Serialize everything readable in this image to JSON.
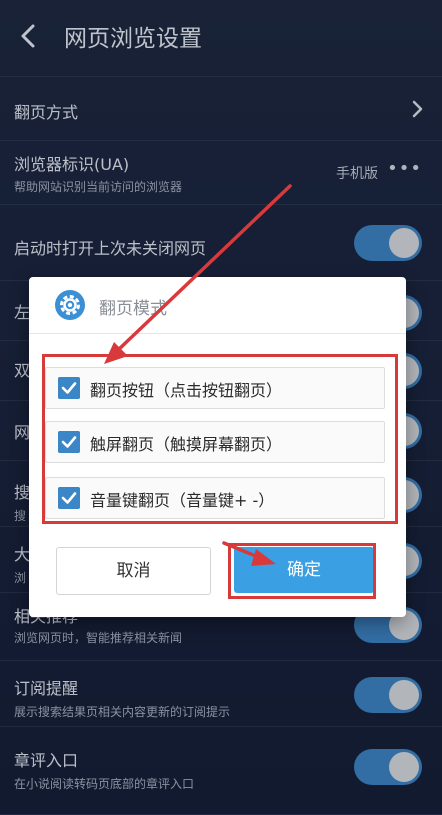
{
  "header": {
    "title": "网页浏览设置"
  },
  "settings": [
    {
      "label": "翻页方式"
    },
    {
      "label": "浏览器标识(UA)",
      "sub": "帮助网站识别当前访问的浏览器",
      "value": "手机版",
      "more": "•••"
    },
    {
      "label": "启动时打开上次未关闭网页",
      "on": true
    },
    {
      "label": "左",
      "on": true
    },
    {
      "label": "双",
      "on": true
    },
    {
      "label": "网",
      "on": true
    },
    {
      "label": "搜",
      "sub": "搜",
      "on": true
    },
    {
      "label": "大",
      "sub": "浏",
      "on": true
    },
    {
      "label": "相关推荐",
      "sub": "浏览网页时，智能推荐相关新闻",
      "on": true
    },
    {
      "label": "订阅提醒",
      "sub": "展示搜索结果页相关内容更新的订阅提示",
      "on": true
    },
    {
      "label": "章评入口",
      "sub": "在小说阅读转码页底部的章评入口",
      "on": true
    }
  ],
  "dialog": {
    "title": "翻页模式",
    "options": [
      {
        "label": "翻页按钮（点击按钮翻页）",
        "checked": true
      },
      {
        "label": "触屏翻页（触摸屏幕翻页）",
        "checked": true
      },
      {
        "label": "音量键翻页（音量键+ -）",
        "checked": true
      }
    ],
    "cancel": "取消",
    "confirm": "确定"
  },
  "colors": {
    "accent": "#3aa0e3",
    "toggle": "#3e86c7",
    "annotation": "#d8393b"
  }
}
